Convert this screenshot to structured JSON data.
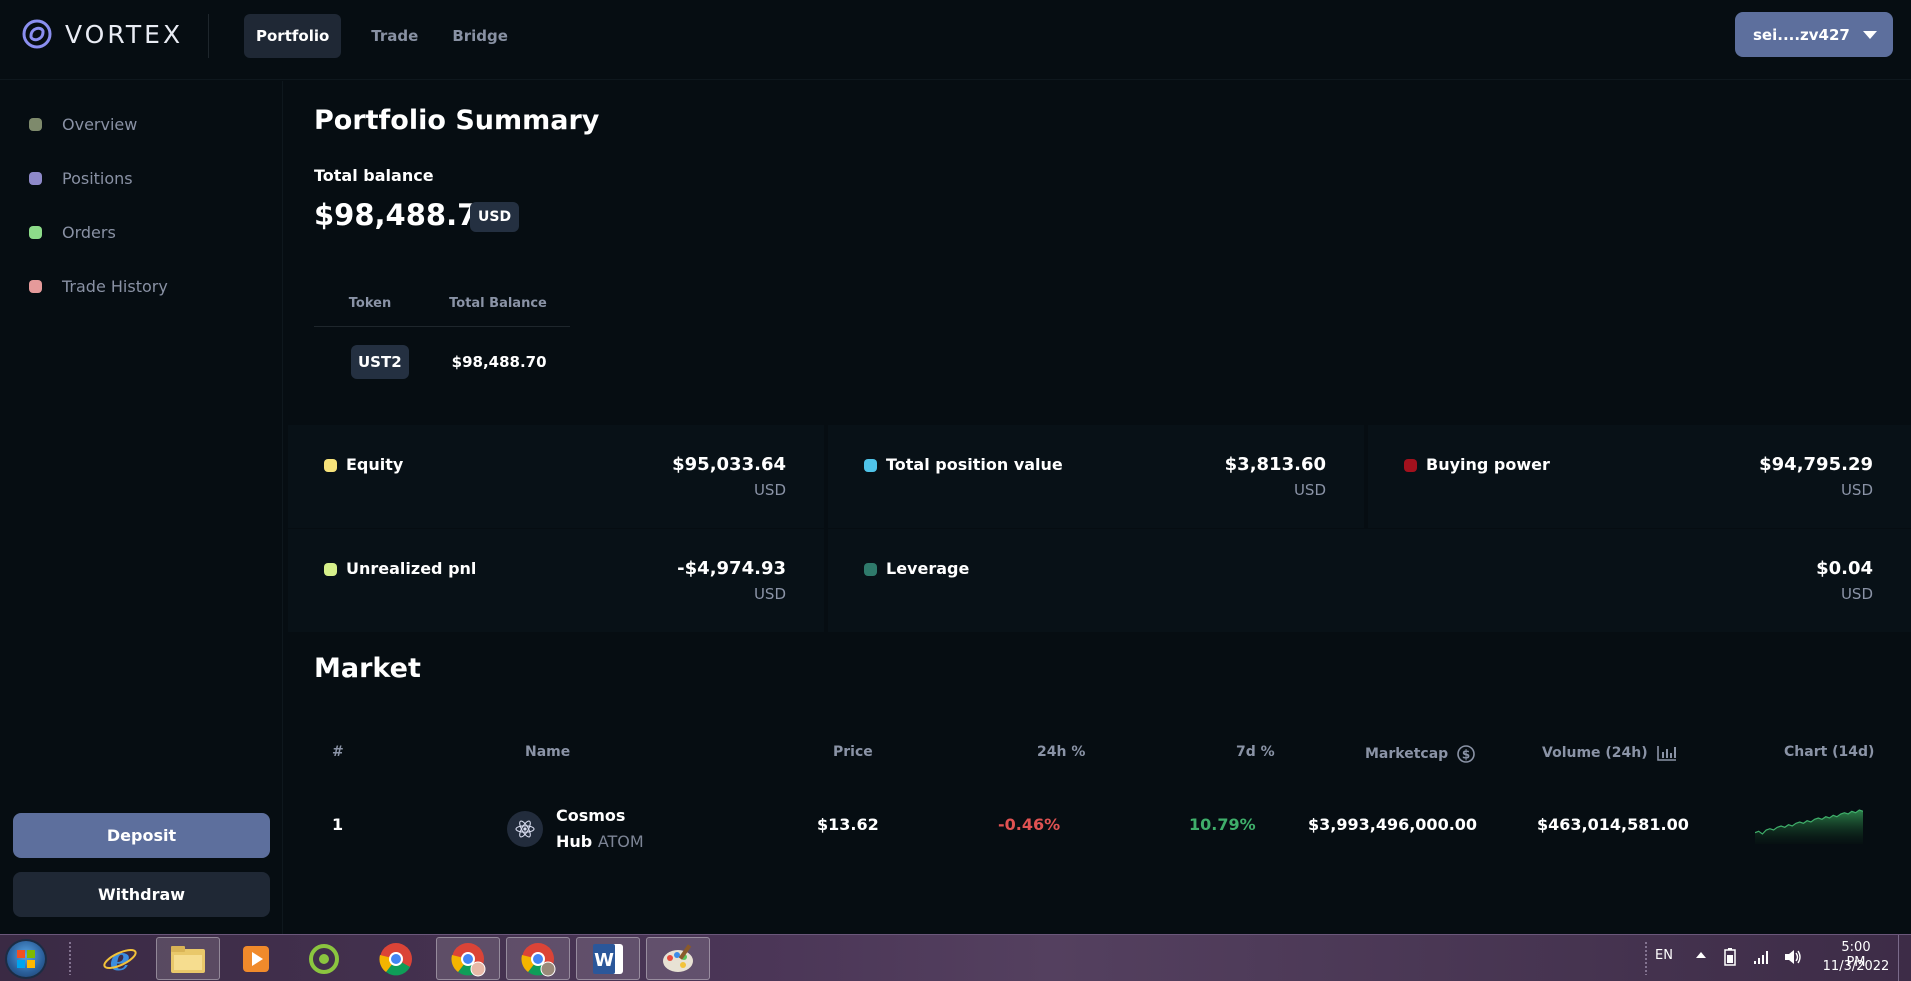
{
  "app": {
    "name": "VORTEX"
  },
  "nav": {
    "tabs": [
      {
        "label": "Portfolio",
        "active": true
      },
      {
        "label": "Trade"
      },
      {
        "label": "Bridge"
      }
    ]
  },
  "wallet": {
    "label": "sei....zv427"
  },
  "sidebar": {
    "items": [
      {
        "label": "Overview",
        "color": "#7e8a6c"
      },
      {
        "label": "Positions",
        "color": "#8e89c9"
      },
      {
        "label": "Orders",
        "color": "#8ddc8a"
      },
      {
        "label": "Trade History",
        "color": "#e59a9a"
      }
    ],
    "deposit_label": "Deposit",
    "withdraw_label": "Withdraw"
  },
  "summary": {
    "title": "Portfolio Summary",
    "total_label": "Total balance",
    "total_value": "$98,488.70",
    "currency": "USD",
    "token_table": {
      "headers": [
        "Token",
        "Total Balance"
      ],
      "rows": [
        {
          "token": "UST2",
          "balance": "$98,488.70"
        }
      ]
    }
  },
  "metrics": [
    {
      "label": "Equity",
      "value": "$95,033.64",
      "unit": "USD",
      "color": "#f6e27a"
    },
    {
      "label": "Total position value",
      "value": "$3,813.60",
      "unit": "USD",
      "color": "#4fc3e8"
    },
    {
      "label": "Buying power",
      "value": "$94,795.29",
      "unit": "USD",
      "color": "#a3111d"
    },
    {
      "label": "Unrealized pnl",
      "value": "-$4,974.93",
      "unit": "USD",
      "color": "#d6f08a"
    },
    {
      "label": "Leverage",
      "value": "$0.04",
      "unit": "USD",
      "color": "#2f7a6b"
    }
  ],
  "market": {
    "title": "Market",
    "headers": [
      "#",
      "Name",
      "Price",
      "24h %",
      "7d %",
      "Marketcap",
      "Volume (24h)",
      "Chart (14d)"
    ],
    "rows": [
      {
        "rank": "1",
        "name_line1": "Cosmos",
        "name_line2": "Hub",
        "symbol": "ATOM",
        "price": "$13.62",
        "change_24h": "-0.46%",
        "change_7d": "10.79%",
        "marketcap": "$3,993,496,000.00",
        "volume": "$463,014,581.00",
        "sparkline": [
          52,
          53,
          51,
          54,
          55,
          54,
          56,
          57,
          56,
          58,
          57,
          59,
          60,
          59,
          61,
          60,
          62,
          63,
          62,
          64,
          63,
          65,
          64,
          66,
          67,
          66,
          68,
          67,
          69,
          68
        ]
      }
    ],
    "negative_color": "#e05252",
    "positive_color": "#3fae6a"
  },
  "taskbar": {
    "apps": [
      "internet-explorer",
      "file-explorer",
      "media-player",
      "app-green",
      "chrome",
      "chrome-user",
      "chrome-user-2",
      "word",
      "paint"
    ],
    "language": "EN",
    "time": "5:00 PM",
    "date": "11/3/2022"
  }
}
